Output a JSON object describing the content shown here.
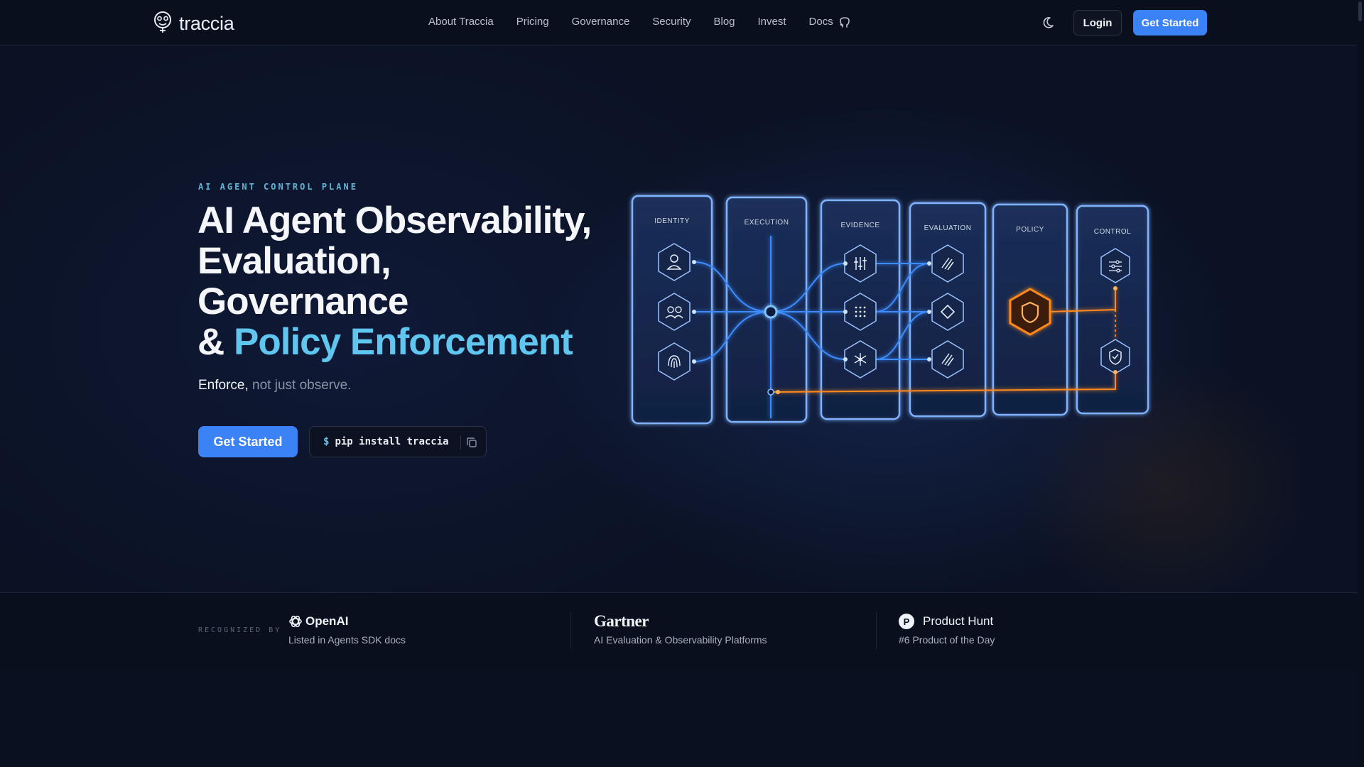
{
  "nav": {
    "logo_text": "traccia",
    "links": [
      "About Traccia",
      "Pricing",
      "Governance",
      "Security",
      "Blog",
      "Invest",
      "Docs"
    ],
    "github_icon": "github-icon",
    "theme_icon": "moon-icon",
    "login_label": "Login",
    "cta_label": "Get Started"
  },
  "hero": {
    "eyebrow": "AI AGENT CONTROL PLANE",
    "headline_line1": "AI Agent Observability,",
    "headline_line2": "Evaluation,",
    "headline_line3": "Governance",
    "headline_amp": "& ",
    "headline_accent": "Policy Enforcement",
    "sub_strong": "Enforce,",
    "sub_rest": " not just observe.",
    "cta_label": "Get Started",
    "pip_prompt": "$",
    "pip_command": "pip install traccia"
  },
  "diagram": {
    "panels": [
      "IDENTITY",
      "EXECUTION",
      "EVIDENCE",
      "EVALUATION",
      "POLICY",
      "CONTROL"
    ],
    "icons": {
      "identity": [
        "user-icon",
        "users-icon",
        "fingerprint-icon"
      ],
      "evidence": [
        "sliders-icon",
        "dots-grid-icon",
        "network-icon"
      ],
      "evaluation": [
        "slash-lines-icon",
        "diamond-icon",
        "slash-lines-icon"
      ],
      "policy": [
        "shield-icon"
      ],
      "control": [
        "settings-sliders-icon",
        "shield-check-icon"
      ]
    },
    "colors": {
      "blue": "#3b8cff",
      "orange": "#ff8a1f",
      "panel": "#7fb2ff"
    }
  },
  "recognized": {
    "label": "RECOGNIZED BY",
    "items": [
      {
        "logo": "OpenAI",
        "desc": "Listed in Agents SDK docs"
      },
      {
        "logo": "Gartner",
        "desc": "AI Evaluation & Observability Platforms"
      },
      {
        "logo": "Product Hunt",
        "badge": "P",
        "desc": "#6 Product of the Day"
      }
    ]
  }
}
